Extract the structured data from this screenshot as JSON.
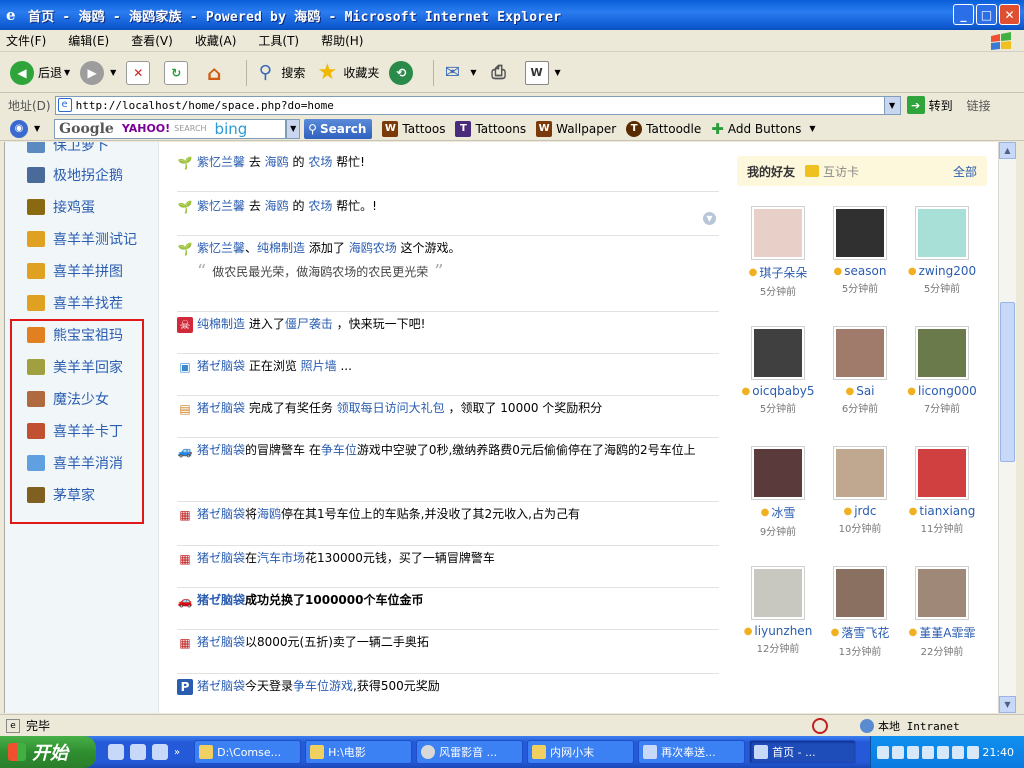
{
  "window": {
    "title": "首页 - 海鸥 - 海鸥家族 - Powered by 海鸥 - Microsoft Internet Explorer",
    "ie_icon": "e",
    "minimize": "_",
    "maximize": "□",
    "close": "✕"
  },
  "menu": [
    "文件(F)",
    "编辑(E)",
    "查看(V)",
    "收藏(A)",
    "工具(T)",
    "帮助(H)"
  ],
  "toolbar": {
    "back": "后退",
    "search": "搜索",
    "favorites": "收藏夹"
  },
  "address": {
    "label": "地址(D)",
    "url": "http://localhost/home/space.php?do=home",
    "go": "转到",
    "links": "链接"
  },
  "googlebar": {
    "google": "Google",
    "yahoo": "YAHOO!",
    "yahoo_search": "SEARCH",
    "bing": "bing",
    "search_button": "Search",
    "links": [
      {
        "icon": "W",
        "label": "Tattoos",
        "color": "#7a3a0a"
      },
      {
        "icon": "T",
        "label": "Tattoons",
        "color": "#4a2a7a"
      },
      {
        "icon": "W",
        "label": "Wallpaper",
        "color": "#7a3a0a"
      },
      {
        "icon": "T",
        "label": "Tattoodle",
        "color": "#5a2a00"
      }
    ],
    "add_buttons": "Add Buttons"
  },
  "sidebar": {
    "items": [
      {
        "label": "保卫萝卜",
        "color": "#5a8ac0"
      },
      {
        "label": "极地拐企鹅",
        "color": "#4a6a9a"
      },
      {
        "label": "接鸡蛋",
        "color": "#8a6a10"
      },
      {
        "label": "喜羊羊测试记",
        "color": "#e0a020"
      },
      {
        "label": "喜羊羊拼图",
        "color": "#e0a020"
      },
      {
        "label": "喜羊羊找茬",
        "color": "#e0a020"
      },
      {
        "label": "熊宝宝祖玛",
        "color": "#e08020"
      },
      {
        "label": "美羊羊回家",
        "color": "#a0a040"
      },
      {
        "label": "魔法少女",
        "color": "#b06a40"
      },
      {
        "label": "喜羊羊卡丁",
        "color": "#c05030"
      },
      {
        "label": "喜羊羊消消",
        "color": "#60a0e0"
      },
      {
        "label": "茅草家",
        "color": "#806020"
      }
    ]
  },
  "feed": {
    "items": [
      {
        "icon": "sprout",
        "parts": [
          [
            "lk",
            "紫忆兰馨"
          ],
          [
            "t",
            " 去 "
          ],
          [
            "lk",
            "海鸥"
          ],
          [
            "t",
            " 的 "
          ],
          [
            "lk",
            "农场"
          ],
          [
            "t",
            " 帮忙!"
          ]
        ]
      },
      {
        "icon": "sprout",
        "parts": [
          [
            "lk",
            "紫忆兰馨"
          ],
          [
            "t",
            " 去 "
          ],
          [
            "lk",
            "海鸥"
          ],
          [
            "t",
            " 的 "
          ],
          [
            "lk",
            "农场"
          ],
          [
            "t",
            " 帮忙。!"
          ]
        ]
      },
      {
        "icon": "sprout",
        "parts": [
          [
            "lk",
            "紫忆兰馨"
          ],
          [
            "t",
            "、"
          ],
          [
            "lk",
            "纯棉制造"
          ],
          [
            "t",
            " 添加了 "
          ],
          [
            "lk",
            "海鸥农场"
          ],
          [
            "t",
            " 这个游戏。"
          ]
        ],
        "quote": "做农民最光荣，做海鸥农场的农民更光荣"
      },
      {
        "icon": "zombie",
        "parts": [
          [
            "lk",
            "纯棉制造"
          ],
          [
            "t",
            " 进入了"
          ],
          [
            "lk",
            "僵尸袭击"
          ],
          [
            "t",
            " ，快来玩一下吧!"
          ]
        ]
      },
      {
        "icon": "photo",
        "parts": [
          [
            "lk",
            "猪ゼ脑袋"
          ],
          [
            "t",
            " 正在浏览 "
          ],
          [
            "lk",
            "照片墙"
          ],
          [
            "t",
            " ..."
          ]
        ]
      },
      {
        "icon": "task",
        "parts": [
          [
            "lk",
            "猪ゼ脑袋"
          ],
          [
            "t",
            " 完成了有奖任务 "
          ],
          [
            "lk",
            "领取每日访问大礼包"
          ],
          [
            "t",
            " ，领取了 10000 个奖励积分"
          ]
        ]
      },
      {
        "icon": "car",
        "parts": [
          [
            "lk",
            "猪ゼ脑袋"
          ],
          [
            "t",
            "的冒牌警车 在"
          ],
          [
            "lk",
            "争车位"
          ],
          [
            "t",
            "游戏中空驶了0秒,缴纳养路费0元后偷偷停在了海鸥的2号车位上"
          ]
        ]
      },
      {
        "icon": "ticket",
        "parts": [
          [
            "lk",
            "猪ゼ脑袋"
          ],
          [
            "t",
            "将"
          ],
          [
            "lk",
            "海鸥"
          ],
          [
            "t",
            "停在其1号车位上的车贴条,并没收了其2元收入,占为己有"
          ]
        ]
      },
      {
        "icon": "ticket",
        "parts": [
          [
            "lk",
            "猪ゼ脑袋"
          ],
          [
            "t",
            "在"
          ],
          [
            "lk",
            "汽车市场"
          ],
          [
            "t",
            "花130000元钱，买了一辆冒牌警车"
          ]
        ]
      },
      {
        "icon": "redcar",
        "parts": [
          [
            "lkb",
            "猪ゼ脑袋"
          ],
          [
            "b",
            "成功兑换了1000000个车位金币"
          ]
        ]
      },
      {
        "icon": "ticket",
        "parts": [
          [
            "lk",
            "猪ゼ脑袋"
          ],
          [
            "t",
            "以8000元(五折)卖了一辆二手奥拓"
          ]
        ]
      },
      {
        "icon": "parking",
        "parts": [
          [
            "lk",
            "猪ゼ脑袋"
          ],
          [
            "t",
            "今天登录"
          ],
          [
            "lk",
            "争车位游戏"
          ],
          [
            "t",
            ",获得500元奖励"
          ]
        ]
      }
    ]
  },
  "friends": {
    "title": "我的好友",
    "card": "互访卡",
    "all": "全部",
    "list": [
      {
        "name": "琪子朵朵",
        "time": "5分钟前",
        "color": "#e8d0c8"
      },
      {
        "name": "season",
        "time": "5分钟前",
        "color": "#303030"
      },
      {
        "name": "zwing200",
        "time": "5分钟前",
        "color": "#a8e0d8"
      },
      {
        "name": "oicqbaby5",
        "time": "5分钟前",
        "color": "#404040"
      },
      {
        "name": "Sai",
        "time": "6分钟前",
        "color": "#a07a6a"
      },
      {
        "name": "licong000",
        "time": "7分钟前",
        "color": "#6a7a4a"
      },
      {
        "name": "冰雪",
        "time": "9分钟前",
        "color": "#5a3a3a"
      },
      {
        "name": "jrdc",
        "time": "10分钟前",
        "color": "#c0a890"
      },
      {
        "name": "tianxiang",
        "time": "11分钟前",
        "color": "#d04040"
      },
      {
        "name": "liyunzhen",
        "time": "12分钟前",
        "color": "#c8c8c0"
      },
      {
        "name": "落雪飞花",
        "time": "13分钟前",
        "color": "#8a7060"
      },
      {
        "name": "堇堇A霏霏",
        "time": "22分钟前",
        "color": "#a08878"
      }
    ]
  },
  "status": {
    "text": "完毕",
    "zone": "本地 Intranet"
  },
  "taskbar": {
    "start": "开始",
    "tasks": [
      "D:\\Comse...",
      "H:\\电影",
      "风雷影音 ...",
      "内网小末",
      "再次奉送...",
      "首页 - ..."
    ],
    "clock": "21:40"
  }
}
